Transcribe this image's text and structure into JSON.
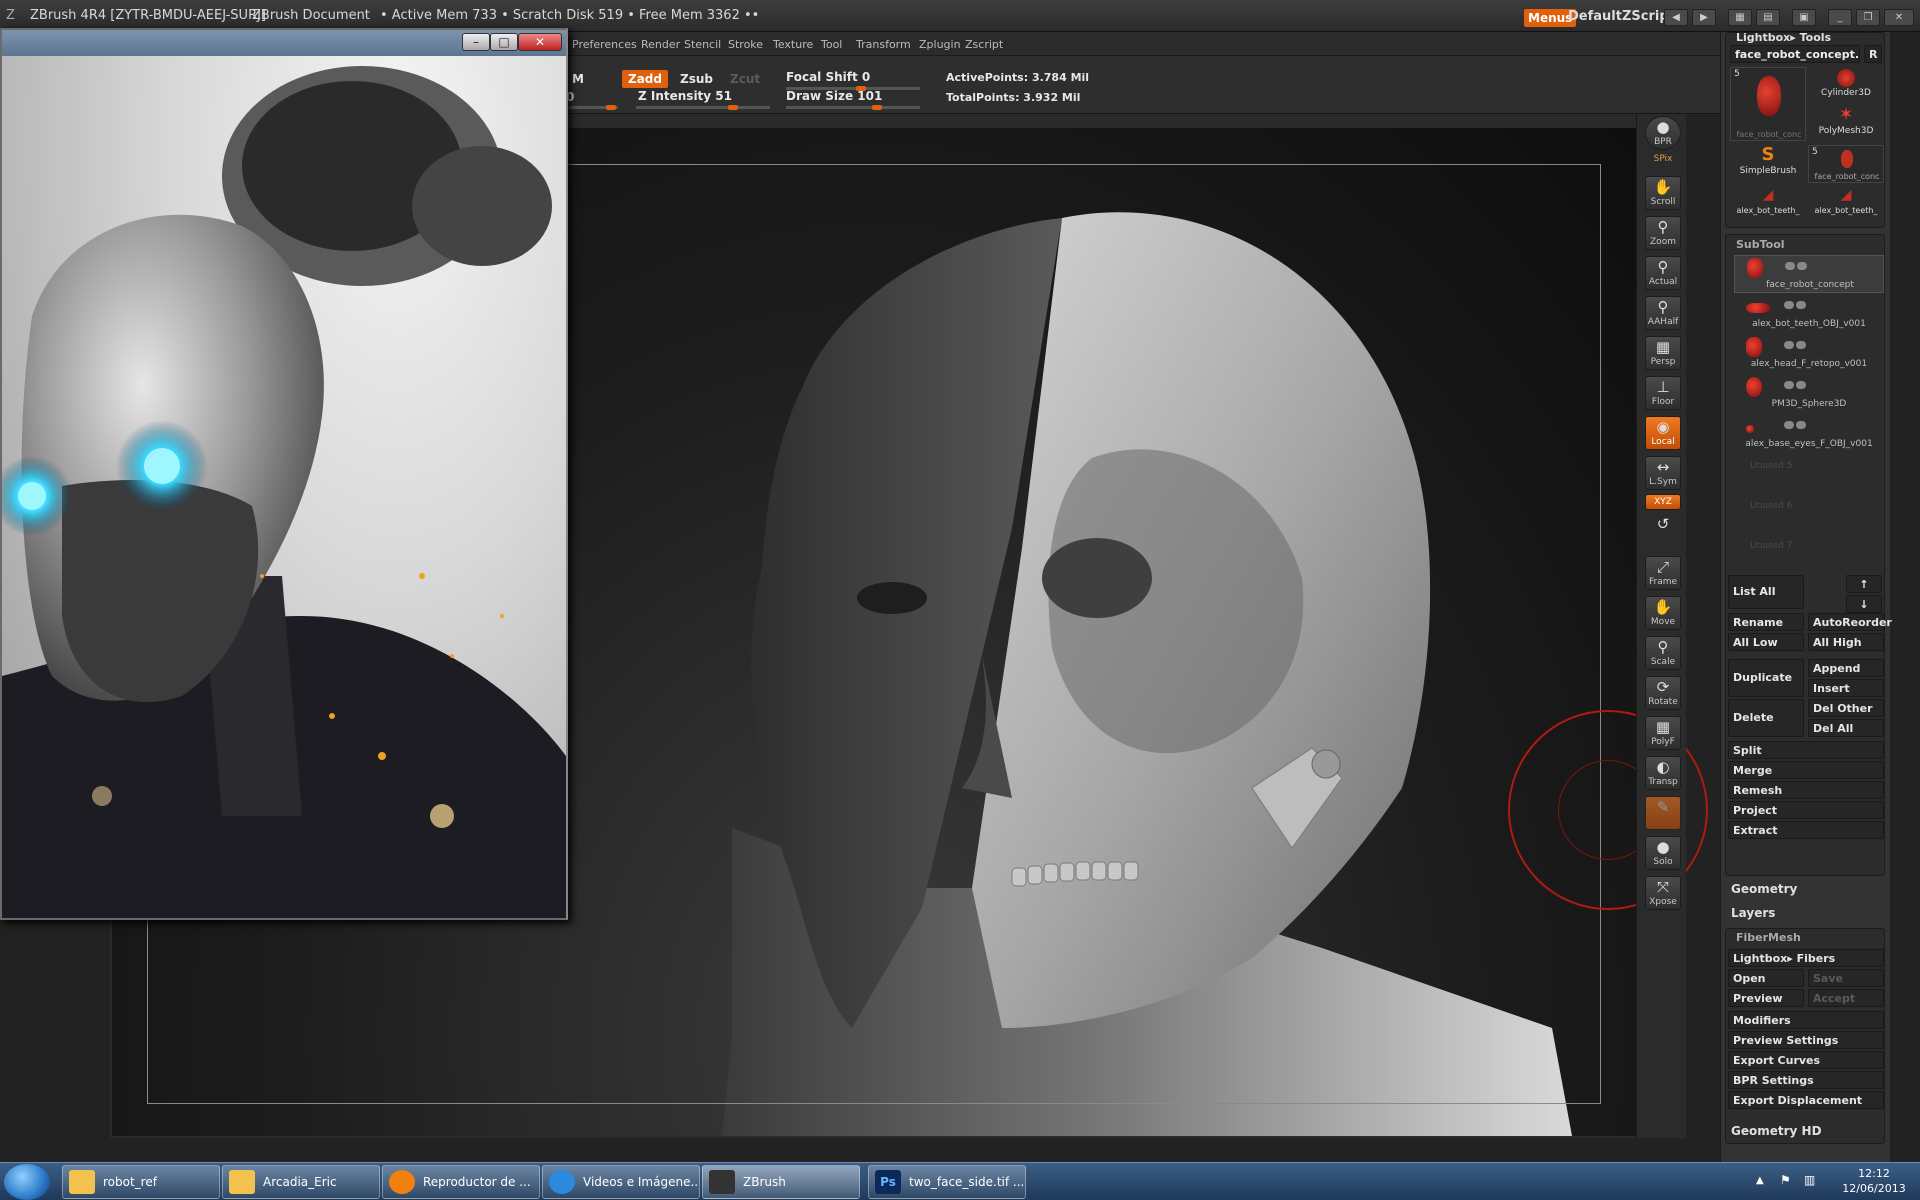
{
  "title_bar": {
    "app": "ZBrush 4R4 [ZYTR-BMDU-AEEJ-SURJ]",
    "document": "ZBrush Document",
    "mem": "• Active Mem 733 • Scratch Disk 519 • Free Mem 3362 ••",
    "menus": "Menus",
    "script": "DefaultZScript"
  },
  "menu_items": [
    "Preferences",
    "Render",
    "Stencil",
    "Stroke",
    "Texture",
    "Tool",
    "Transform",
    "Zplugin",
    "Zscript"
  ],
  "toolbar": {
    "m": "M",
    "zadd": "Zadd",
    "zsub": "Zsub",
    "zcut": "Zcut",
    "focal_shift": "Focal Shift 0",
    "z_intensity": "Z Intensity 51",
    "draw_size": "Draw Size 101",
    "active_points": "ActivePoints: 3.784 Mil",
    "total_points": "TotalPoints: 3.932 Mil",
    "zero": "0"
  },
  "shelf": [
    "BPR",
    "SPix",
    "Scroll",
    "Zoom",
    "Actual",
    "AAHalf",
    "Persp",
    "Floor",
    "Local",
    "L.Sym",
    "XYZ",
    "Frame",
    "Move",
    "Scale",
    "Rotate",
    "PolyF",
    "Transp",
    "Solo",
    "Xpose"
  ],
  "tool_panel": {
    "header": "Lightbox▸ Tools",
    "current": "face_robot_concept.",
    "r": "R",
    "num1": "5",
    "num2": "5",
    "thumbs": [
      "face_robot_conc",
      "Cylinder3D",
      "PolyMesh3D",
      "SimpleBrush",
      "face_robot_conc",
      "alex_bot_teeth_",
      "alex_bot_teeth_"
    ]
  },
  "subtool": {
    "header": "SubTool",
    "items": [
      "face_robot_concept",
      "alex_bot_teeth_OBJ_v001",
      "alex_head_F_retopo_v001",
      "PM3D_Sphere3D",
      "alex_base_eyes_F_OBJ_v001"
    ],
    "unused": [
      "Unused 5",
      "Unused 6",
      "Unused 7"
    ]
  },
  "subtool_buttons": {
    "list_all": "List All",
    "rename": "Rename",
    "auto_reorder": "AutoReorder",
    "all_low": "All Low",
    "all_high": "All High",
    "duplicate": "Duplicate",
    "append": "Append",
    "insert": "Insert",
    "delete": "Delete",
    "del_other": "Del Other",
    "del_all": "Del All",
    "split": "Split",
    "merge": "Merge",
    "remesh": "Remesh",
    "project": "Project",
    "extract": "Extract"
  },
  "sections": {
    "geometry": "Geometry",
    "layers": "Layers",
    "fibermesh": "FiberMesh",
    "geometry_hd": "Geometry HD"
  },
  "fibermesh": {
    "lightbox_fibers": "Lightbox▸ Fibers",
    "open": "Open",
    "save": "Save",
    "preview": "Preview",
    "accept": "Accept",
    "modifiers": "Modifiers",
    "preview_settings": "Preview Settings",
    "export_curves": "Export Curves",
    "bpr_settings": "BPR Settings",
    "export_displacement": "Export Displacement"
  },
  "taskbar": {
    "items": [
      "robot_ref",
      "Arcadia_Eric",
      "Reproductor de ...",
      "Videos e Imágene...",
      "ZBrush",
      "two_face_side.tif ..."
    ],
    "time": "12:12",
    "date": "12/06/2013"
  },
  "colors": {
    "accent": "#e0600c",
    "brush_circle": "#b01a10"
  }
}
